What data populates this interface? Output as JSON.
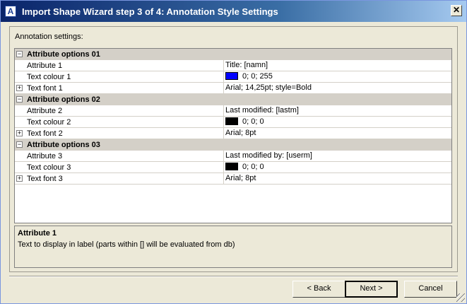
{
  "window": {
    "title": "Import Shape Wizard step 3 of 4: Annotation Style Settings",
    "close_label": "✕"
  },
  "settings_label": "Annotation settings:",
  "grid": {
    "rows": [
      {
        "kind": "category",
        "expander": "−",
        "name": "Attribute options 01"
      },
      {
        "kind": "prop",
        "name": "Attribute   1",
        "value": "Title: [namn]"
      },
      {
        "kind": "prop",
        "name": "Text colour   1",
        "value": "0; 0; 255",
        "color": "#0000ff"
      },
      {
        "kind": "prop",
        "expander": "+",
        "name": "Text font   1",
        "value": "Arial; 14,25pt; style=Bold"
      },
      {
        "kind": "category",
        "expander": "−",
        "name": "Attribute options 02"
      },
      {
        "kind": "prop",
        "name": "Attribute   2",
        "value": "Last modified: [lastm]"
      },
      {
        "kind": "prop",
        "name": "Text colour   2",
        "value": "0; 0; 0",
        "color": "#000000"
      },
      {
        "kind": "prop",
        "expander": "+",
        "name": "Text font   2",
        "value": "Arial; 8pt"
      },
      {
        "kind": "category",
        "expander": "−",
        "name": "Attribute options 03"
      },
      {
        "kind": "prop",
        "name": "Attribute   3",
        "value": "Last modified by: [userm]"
      },
      {
        "kind": "prop",
        "name": "Text colour   3",
        "value": "0; 0; 0",
        "color": "#000000"
      },
      {
        "kind": "prop",
        "expander": "+",
        "name": "Text font   3",
        "value": "Arial; 8pt"
      }
    ]
  },
  "description": {
    "title": "Attribute   1",
    "text": "Text to display in label (parts within [] will be evaluated from db)"
  },
  "buttons": {
    "back": "< Back",
    "next": "Next >",
    "cancel": "Cancel"
  }
}
